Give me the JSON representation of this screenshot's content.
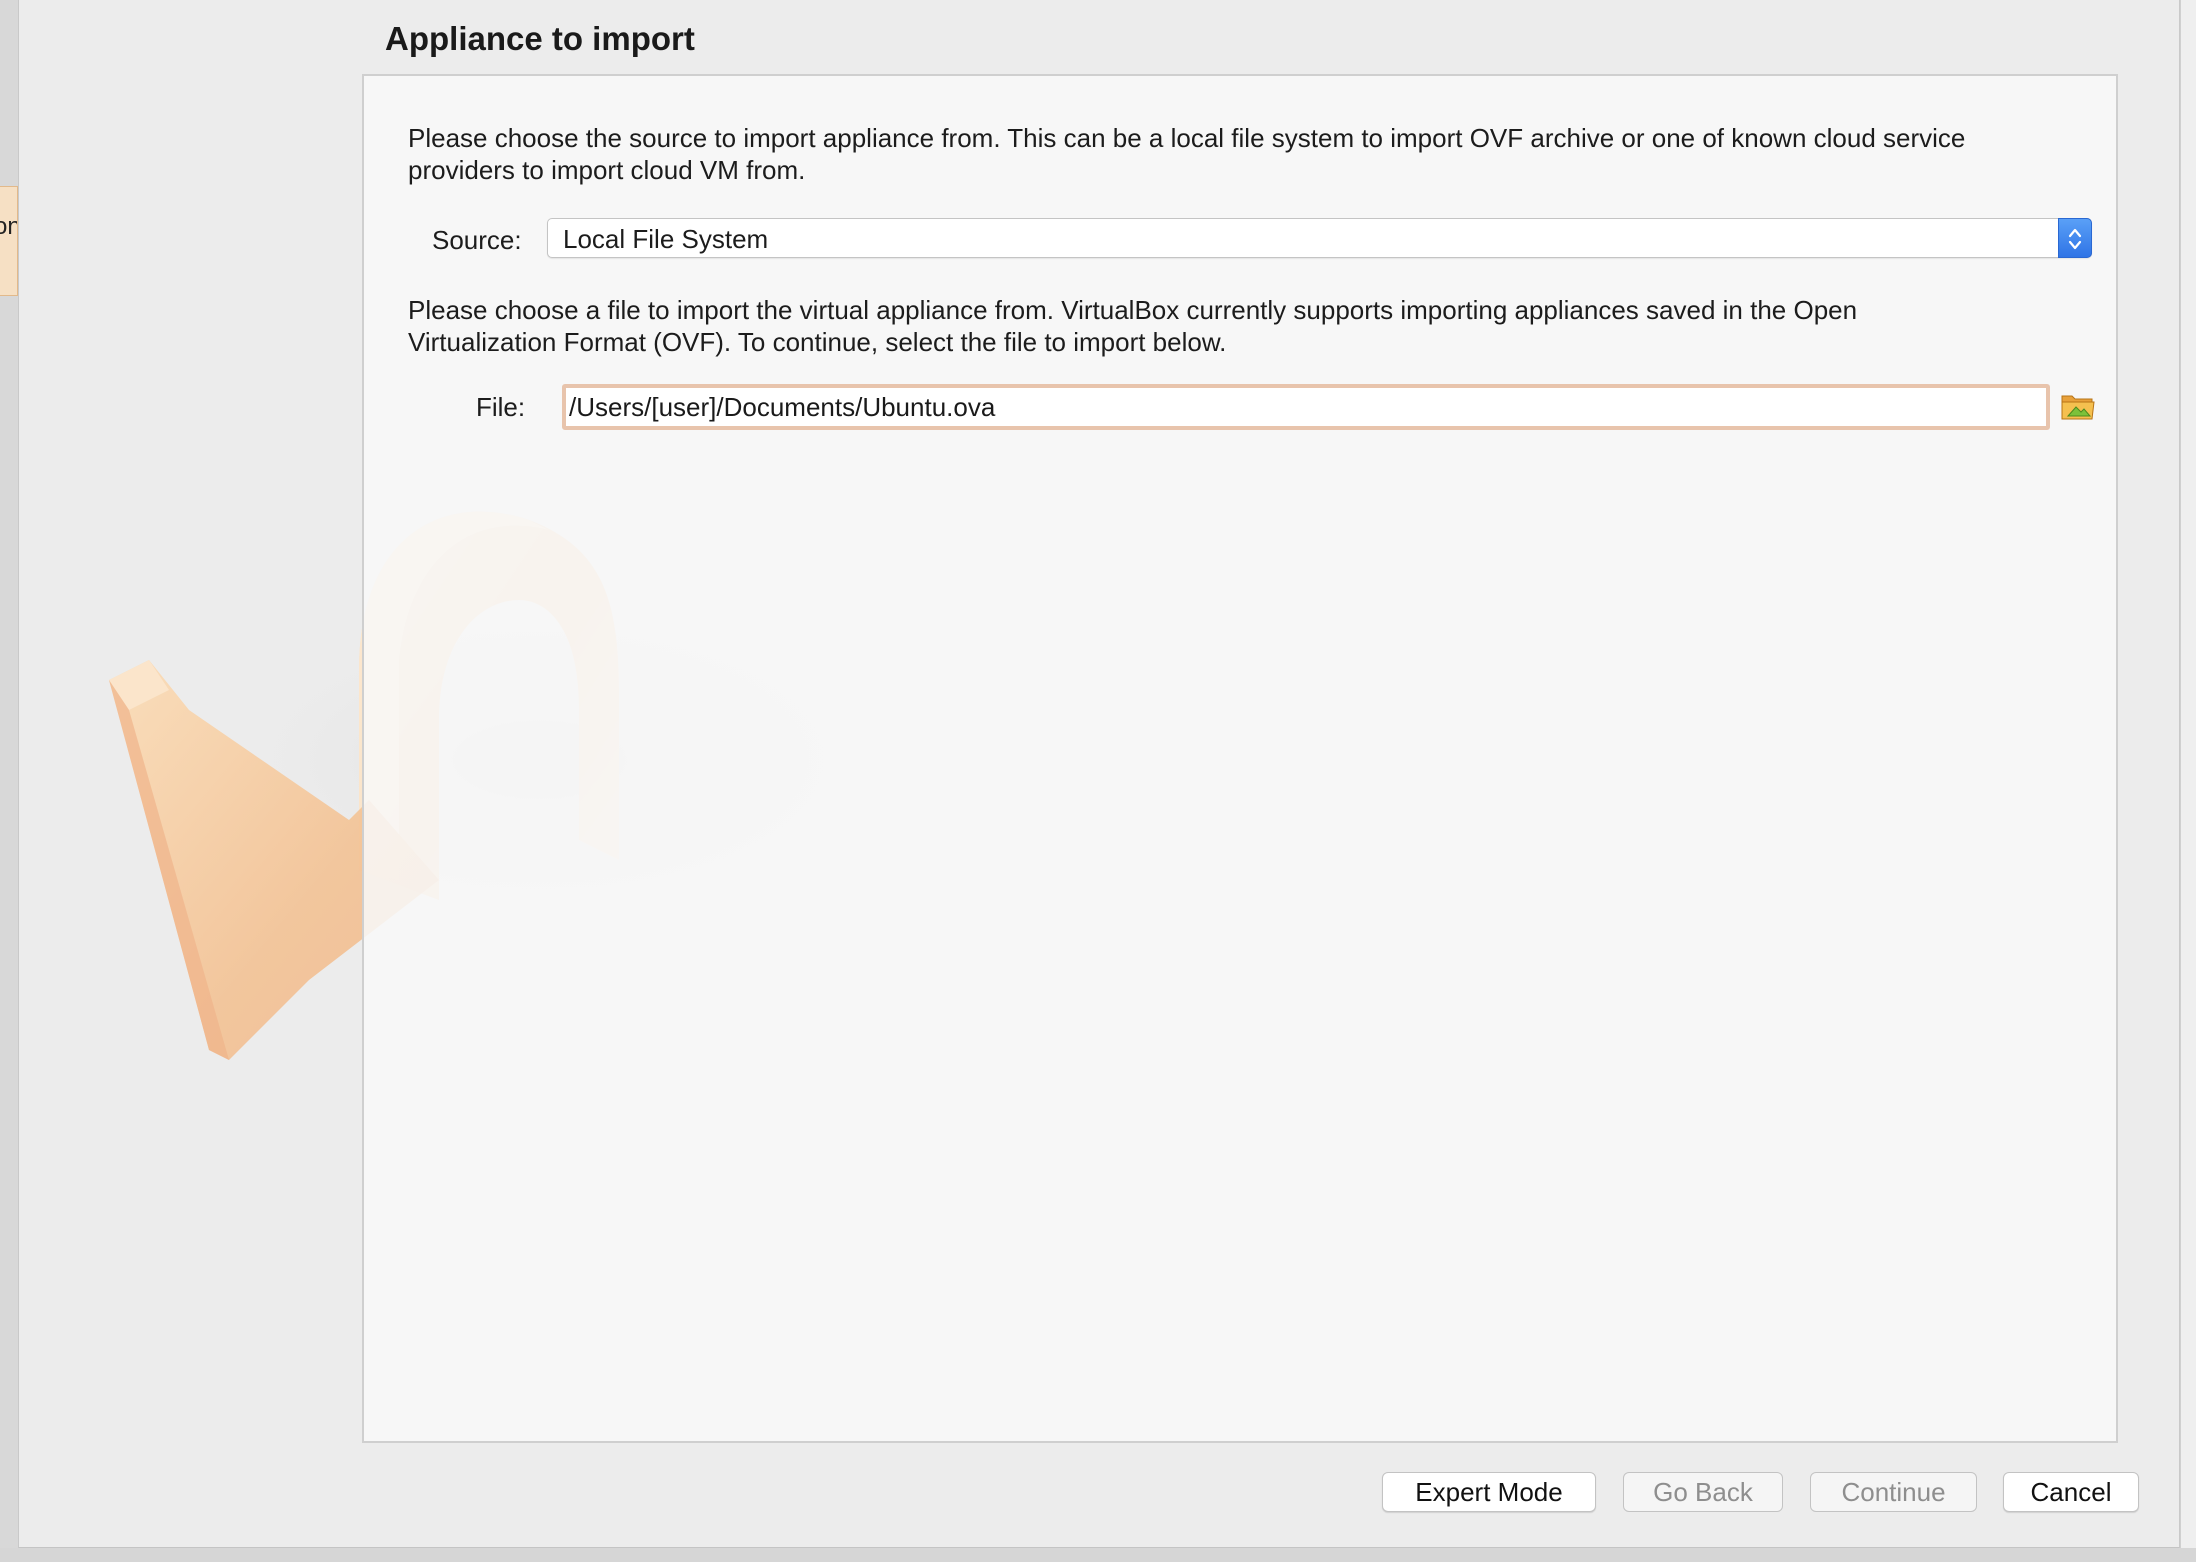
{
  "background": {
    "left_tab_fragment": "on"
  },
  "dialog": {
    "page_title": "Appliance to import",
    "source_description": "Please choose the source to import appliance from. This can be a local file system to import OVF archive or one of known cloud service\nproviders to import cloud VM from.",
    "source_label": "Source:",
    "source_value": "Local File System",
    "file_description": "Please choose a file to import the virtual appliance from. VirtualBox currently supports importing appliances saved in the Open\nVirtualization Format (OVF). To continue, select the file to import below.",
    "file_label": "File:",
    "file_value": "/Users/[user]/Documents/Ubuntu.ova",
    "buttons": {
      "expert_mode": "Expert Mode",
      "go_back": "Go Back",
      "continue": "Continue",
      "cancel": "Cancel"
    },
    "button_states": {
      "go_back_enabled": false,
      "continue_enabled": false
    }
  },
  "icons": {
    "watermark": "import-arrow-icon",
    "select_stepper": "chevron-updown-icon",
    "folder": "open-folder-icon"
  },
  "colors": {
    "dialog_background": "#ececec",
    "panel_background": "#f8f8f8",
    "focus_ring": "#e8c4ac",
    "select_accent": "#2f74e6",
    "watermark_orange": "#f3c89a"
  }
}
